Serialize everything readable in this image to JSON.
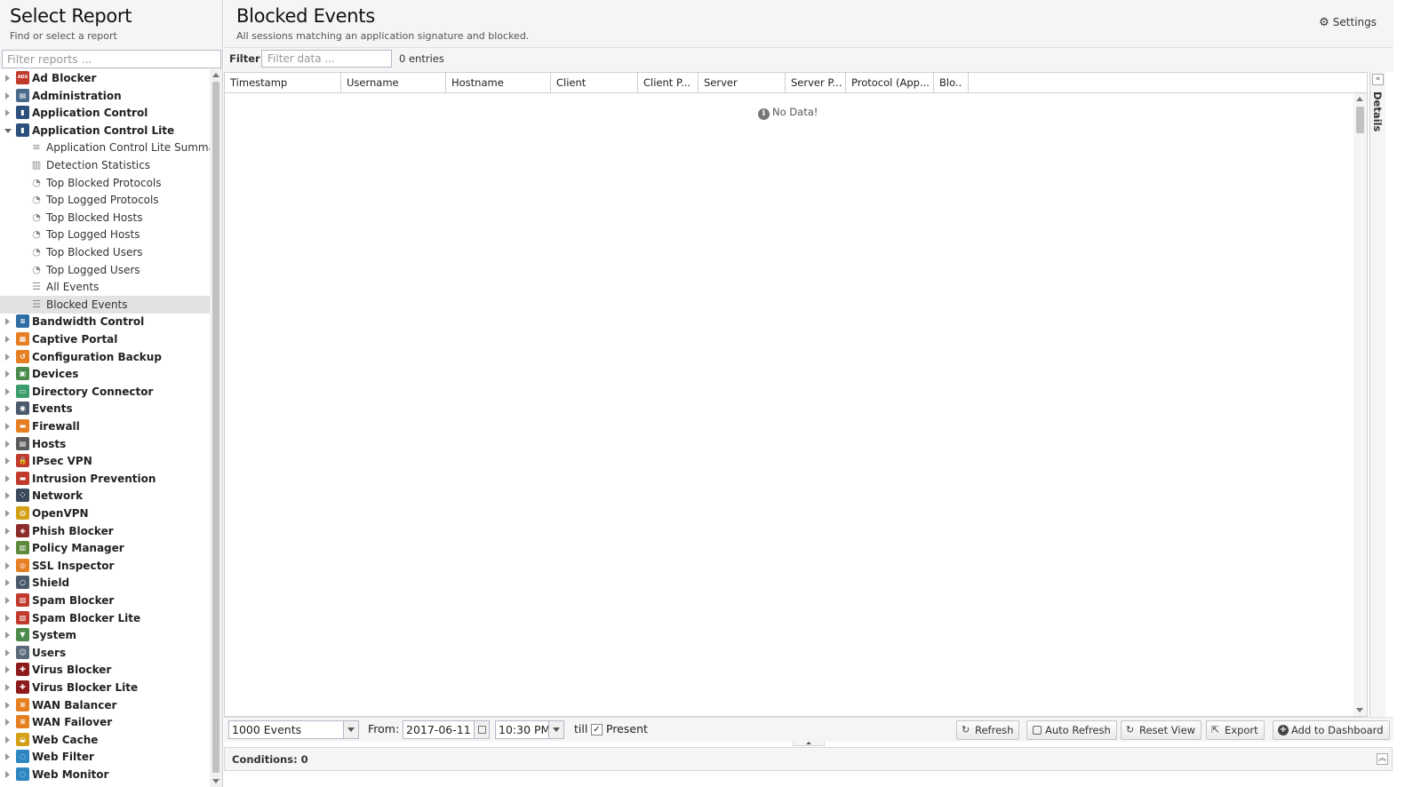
{
  "left_panel": {
    "title": "Select Report",
    "subtitle": "Find or select a report",
    "filter_placeholder": "Filter reports ..."
  },
  "tree": [
    {
      "label": "Ad Blocker",
      "icon": "ad-blocker-icon",
      "color": "#c0392b",
      "glyph": "ADS"
    },
    {
      "label": "Administration",
      "icon": "administration-icon",
      "color": "#4a6b8a",
      "glyph": "▤"
    },
    {
      "label": "Application Control",
      "icon": "application-control-icon",
      "color": "#2c4f7c",
      "glyph": "▮"
    },
    {
      "label": "Application Control Lite",
      "icon": "application-control-lite-icon",
      "color": "#2c4f7c",
      "glyph": "▮",
      "expanded": true,
      "children": [
        {
          "label": "Application Control Lite Summary",
          "icon": "text-report-icon",
          "glyph": "≡"
        },
        {
          "label": "Detection Statistics",
          "icon": "bar-chart-icon",
          "glyph": "▥"
        },
        {
          "label": "Top Blocked Protocols",
          "icon": "pie-chart-icon",
          "glyph": "◔"
        },
        {
          "label": "Top Logged Protocols",
          "icon": "pie-chart-icon",
          "glyph": "◔"
        },
        {
          "label": "Top Blocked Hosts",
          "icon": "pie-chart-icon",
          "glyph": "◔"
        },
        {
          "label": "Top Logged Hosts",
          "icon": "pie-chart-icon",
          "glyph": "◔"
        },
        {
          "label": "Top Blocked Users",
          "icon": "pie-chart-icon",
          "glyph": "◔"
        },
        {
          "label": "Top Logged Users",
          "icon": "pie-chart-icon",
          "glyph": "◔"
        },
        {
          "label": "All Events",
          "icon": "events-list-icon",
          "glyph": "☰"
        },
        {
          "label": "Blocked Events",
          "icon": "events-list-icon",
          "glyph": "☰",
          "selected": true
        }
      ]
    },
    {
      "label": "Bandwidth Control",
      "icon": "bandwidth-control-icon",
      "color": "#2e6da4",
      "glyph": "≋"
    },
    {
      "label": "Captive Portal",
      "icon": "captive-portal-icon",
      "color": "#e67e22",
      "glyph": "▦"
    },
    {
      "label": "Configuration Backup",
      "icon": "configuration-backup-icon",
      "color": "#e67e22",
      "glyph": "↺"
    },
    {
      "label": "Devices",
      "icon": "devices-icon",
      "color": "#4a8a4a",
      "glyph": "▣"
    },
    {
      "label": "Directory Connector",
      "icon": "directory-connector-icon",
      "color": "#3a9b6b",
      "glyph": "▭"
    },
    {
      "label": "Events",
      "icon": "events-icon",
      "color": "#4a5a6a",
      "glyph": "◉"
    },
    {
      "label": "Firewall",
      "icon": "firewall-icon",
      "color": "#e67e22",
      "glyph": "▬"
    },
    {
      "label": "Hosts",
      "icon": "hosts-icon",
      "color": "#5a5a5a",
      "glyph": "▤"
    },
    {
      "label": "IPsec VPN",
      "icon": "ipsec-vpn-icon",
      "color": "#c0392b",
      "glyph": "🔒"
    },
    {
      "label": "Intrusion Prevention",
      "icon": "intrusion-prevention-icon",
      "color": "#c0392b",
      "glyph": "▬"
    },
    {
      "label": "Network",
      "icon": "network-icon",
      "color": "#3a4a5a",
      "glyph": "⁘"
    },
    {
      "label": "OpenVPN",
      "icon": "openvpn-icon",
      "color": "#d4a017",
      "glyph": "◍"
    },
    {
      "label": "Phish Blocker",
      "icon": "phish-blocker-icon",
      "color": "#8e2b2b",
      "glyph": "◈"
    },
    {
      "label": "Policy Manager",
      "icon": "policy-manager-icon",
      "color": "#5b8a3a",
      "glyph": "▥"
    },
    {
      "label": "SSL Inspector",
      "icon": "ssl-inspector-icon",
      "color": "#e67e22",
      "glyph": "◎"
    },
    {
      "label": "Shield",
      "icon": "shield-icon",
      "color": "#4a5a6a",
      "glyph": "○"
    },
    {
      "label": "Spam Blocker",
      "icon": "spam-blocker-icon",
      "color": "#c0392b",
      "glyph": "▧"
    },
    {
      "label": "Spam Blocker Lite",
      "icon": "spam-blocker-lite-icon",
      "color": "#c0392b",
      "glyph": "▧"
    },
    {
      "label": "System",
      "icon": "system-icon",
      "color": "#4a8a4a",
      "glyph": "▼"
    },
    {
      "label": "Users",
      "icon": "users-icon",
      "color": "#5a6a7a",
      "glyph": "☺"
    },
    {
      "label": "Virus Blocker",
      "icon": "virus-blocker-icon",
      "color": "#8e1b1b",
      "glyph": "✚"
    },
    {
      "label": "Virus Blocker Lite",
      "icon": "virus-blocker-lite-icon",
      "color": "#8e1b1b",
      "glyph": "✚"
    },
    {
      "label": "WAN Balancer",
      "icon": "wan-balancer-icon",
      "color": "#e67e22",
      "glyph": "≡"
    },
    {
      "label": "WAN Failover",
      "icon": "wan-failover-icon",
      "color": "#e67e22",
      "glyph": "≡"
    },
    {
      "label": "Web Cache",
      "icon": "web-cache-icon",
      "color": "#d4a017",
      "glyph": "◒"
    },
    {
      "label": "Web Filter",
      "icon": "web-filter-icon",
      "color": "#2e86c1",
      "glyph": "◌"
    },
    {
      "label": "Web Monitor",
      "icon": "web-monitor-icon",
      "color": "#2e86c1",
      "glyph": "◌"
    }
  ],
  "main": {
    "title": "Blocked Events",
    "subtitle": "All sessions matching an application signature and blocked.",
    "settings_label": "Settings",
    "filter_label": "Filter:",
    "filter_placeholder": "Filter data ...",
    "entries": "0 entries",
    "no_data": "No Data!",
    "details_label": "Details",
    "columns": [
      "Timestamp",
      "Username",
      "Hostname",
      "Client",
      "Client P...",
      "Server",
      "Server P...",
      "Protocol (App...",
      "Blo.."
    ]
  },
  "bottom": {
    "events_limit": "1000 Events",
    "from_label": "From:",
    "from_date": "2017-06-11",
    "from_time": "10:30 PM",
    "till_label": "till",
    "present_label": "Present",
    "present_checked": true,
    "refresh": "Refresh",
    "auto_refresh": "Auto Refresh",
    "reset_view": "Reset View",
    "export": "Export",
    "add_to_dashboard": "Add to Dashboard"
  },
  "conditions": {
    "label": "Conditions: 0"
  }
}
